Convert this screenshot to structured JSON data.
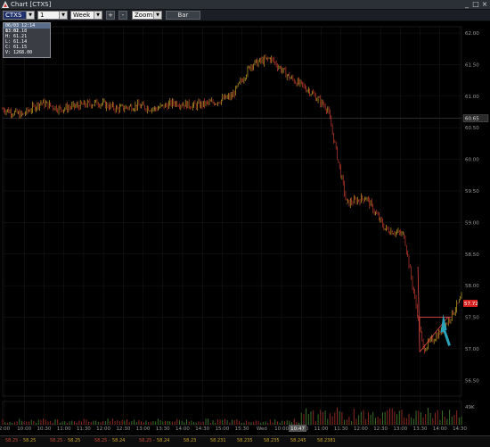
{
  "window": {
    "title": "Chart [CTXS]"
  },
  "toolbar": {
    "symbol": "CTXS",
    "interval": "1 minute",
    "range": "Week",
    "plus_label": "+",
    "minus_label": "-",
    "zoom": "Zoom",
    "bar_label": "Bar"
  },
  "ohlc_panel": {
    "date": "06/03 12:14 13:02",
    "o": "O: 61.18",
    "h": "H: 61.21",
    "l": "L: 61.14",
    "c": "C: 61.15",
    "v": "V: 1268.00"
  },
  "price_axis": {
    "ticks": [
      "62.00",
      "61.50",
      "61.00",
      "60.50",
      "60.00",
      "59.50",
      "59.00",
      "58.50",
      "58.00",
      "57.50",
      "57.00",
      "56.50"
    ],
    "last_price": "57.72",
    "crosshair_price": "60.65"
  },
  "volume_axis": {
    "label": "49K"
  },
  "time_axis": {
    "labels": [
      "2:00",
      "10:00",
      "10:30",
      "11:00",
      "11:30",
      "12:00",
      "12:30",
      "13:00",
      "13:30",
      "14:00",
      "14:30",
      "15:00",
      "15:30",
      "Wed",
      "10:00",
      "10:30",
      "11:00",
      "11:30",
      "12:00",
      "12:30",
      "13:00",
      "13:30",
      "14:00",
      "14:30"
    ],
    "cursor_label": "10:47"
  },
  "status_bar": {
    "items": [
      "58.25",
      "58.25",
      "58.24",
      "58.24",
      "58.23",
      "58.231",
      "58.235",
      "58.235",
      "58.245",
      "58.2381"
    ],
    "faint": [
      "58.25 -",
      "58.25 -",
      "58.25 -",
      "58.25 -"
    ]
  },
  "colors": {
    "background": "#000000",
    "grid": "#1a1a1a",
    "candle_up": "#c9a227",
    "candle_down": "#c23b2e",
    "trendline": "#e04848",
    "arrow": "#2aa3b8",
    "last_price_tag": "#d62020"
  },
  "chart_data": {
    "type": "line",
    "title": "",
    "xlabel": "",
    "ylabel": "",
    "ylim": [
      56.25,
      62.1
    ],
    "x": [
      "2:00",
      "10:00",
      "10:30",
      "11:00",
      "11:30",
      "12:00",
      "12:30",
      "13:00",
      "13:30",
      "14:00",
      "14:30",
      "15:00",
      "15:30",
      "Wed",
      "10:00",
      "10:30",
      "11:00",
      "11:30",
      "12:00",
      "12:30",
      "13:00",
      "13:30",
      "14:00",
      "14:30",
      "14:45"
    ],
    "series": [
      {
        "values": [
          60.8,
          60.7,
          60.9,
          60.8,
          60.85,
          60.9,
          60.8,
          60.85,
          60.8,
          60.9,
          60.85,
          60.9,
          61.0,
          61.5,
          61.6,
          61.3,
          61.1,
          60.8,
          59.3,
          59.4,
          58.9,
          58.8,
          57.0,
          57.3,
          57.8
        ]
      }
    ],
    "volume": {
      "axis_max_label": "49K"
    },
    "annotations": [
      "trend lines",
      "arrow"
    ]
  }
}
